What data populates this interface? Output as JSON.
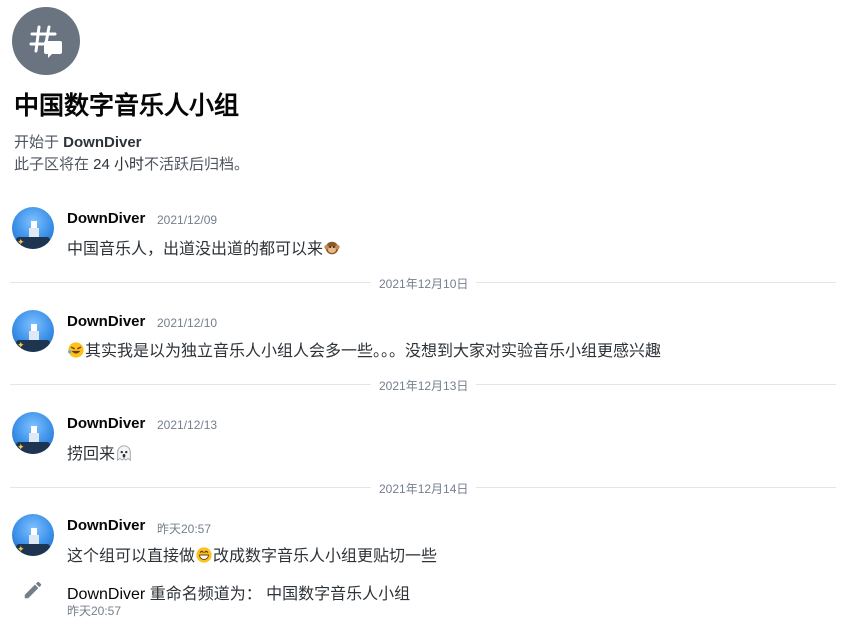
{
  "thread": {
    "icon": "thread-hash-chat-icon",
    "title": "中国数字音乐人小组",
    "started_by_prefix": "开始于 ",
    "started_by_user": "DownDiver",
    "archive_prefix": "此子区将在 ",
    "archive_duration": "24 小时",
    "archive_suffix": "不活跃后归档。"
  },
  "messages": [
    {
      "author": "DownDiver",
      "time": "2021/12/09",
      "text": "中国音乐人，出道没出道的都可以来",
      "emoji": "monkey-emoji"
    },
    {
      "author": "DownDiver",
      "time": "2021/12/10",
      "emoji_lead": "rofl-emoji",
      "text": "其实我是以为独立音乐人小组人会多一些。。。没想到大家对实验音乐小组更感兴趣"
    },
    {
      "author": "DownDiver",
      "time": "2021/12/13",
      "text": "捞回来",
      "emoji": "ghost-emoji"
    },
    {
      "author": "DownDiver",
      "time": "昨天20:57",
      "text_before": "这个组可以直接做",
      "emoji": "grin-emoji",
      "text_after": "改成数字音乐人小组更贴切一些"
    }
  ],
  "dividers": [
    "2021年12月10日",
    "2021年12月13日",
    "2021年12月14日"
  ],
  "system_message": {
    "icon": "pencil-icon",
    "author": "DownDiver",
    "text": " 重命名频道为： 中国数字音乐人小组",
    "time": "昨天20:57"
  }
}
